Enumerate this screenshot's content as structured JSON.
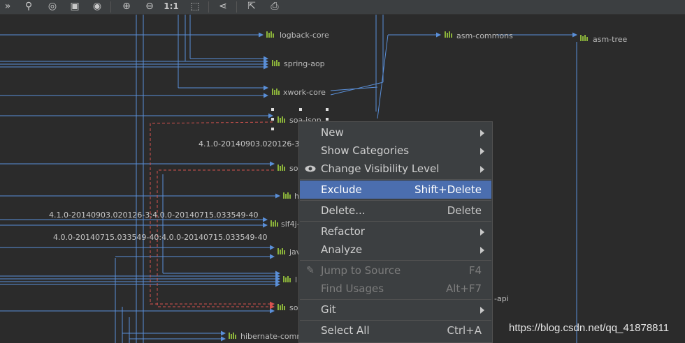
{
  "toolbar": {
    "buttons": [
      {
        "name": "expand-icon",
        "glyph": "»"
      },
      {
        "name": "tree-icon",
        "glyph": "⚲"
      },
      {
        "name": "locate-icon",
        "glyph": "◎"
      },
      {
        "name": "fit-icon",
        "glyph": "▣"
      },
      {
        "name": "eye-icon",
        "glyph": "◉"
      },
      {
        "name": "zoom-in-icon",
        "glyph": "⊕"
      },
      {
        "name": "zoom-out-icon",
        "glyph": "⊖"
      },
      {
        "name": "actual-size-icon",
        "glyph": "1:1"
      },
      {
        "name": "fit-content-icon",
        "glyph": "⬚"
      },
      {
        "name": "share-icon",
        "glyph": "⋖"
      },
      {
        "name": "export-icon",
        "glyph": "⇱"
      },
      {
        "name": "print-icon",
        "glyph": "⎙"
      }
    ]
  },
  "graph": {
    "nodes": {
      "logback_core": "logback-core",
      "spring_aop": "spring-aop",
      "xwork_core": "xwork-core",
      "soa_json": "soa-json",
      "asm_commons": "asm-commons",
      "asm_tree": "asm-tree",
      "soa_2": "so",
      "h_node": "h",
      "slf4j": "slf4j-",
      "java_node": "jav",
      "l_node": "l",
      "soa_3": "so",
      "hibernate_commons": "hibernate-comm",
      "api_node": "-api"
    },
    "edge_labels": {
      "label_1": "4.1.0-20140903.020126-3",
      "label_2": "4.1.0-20140903.020126-3:4.0.0-20140715.033549-40",
      "label_3": "4.0.0-20140715.033549-40:4.0.0-20140715.033549-40"
    }
  },
  "context_menu": {
    "items": [
      {
        "label": "New",
        "shortcut": "",
        "submenu": true,
        "enabled": true
      },
      {
        "label": "Show Categories",
        "shortcut": "",
        "submenu": true,
        "enabled": true
      },
      {
        "label": "Change Visibility Level",
        "shortcut": "",
        "submenu": true,
        "enabled": true,
        "icon": "eye-icon"
      },
      {
        "label": "Exclude",
        "shortcut": "Shift+Delete",
        "submenu": false,
        "enabled": true,
        "selected": true
      },
      {
        "label": "Delete...",
        "shortcut": "Delete",
        "submenu": false,
        "enabled": true
      },
      {
        "label": "Refactor",
        "shortcut": "",
        "submenu": true,
        "enabled": true
      },
      {
        "label": "Analyze",
        "shortcut": "",
        "submenu": true,
        "enabled": true
      },
      {
        "label": "Jump to Source",
        "shortcut": "F4",
        "submenu": false,
        "enabled": false,
        "icon": "pencil-icon"
      },
      {
        "label": "Find Usages",
        "shortcut": "Alt+F7",
        "submenu": false,
        "enabled": false
      },
      {
        "label": "Git",
        "shortcut": "",
        "submenu": true,
        "enabled": true
      },
      {
        "label": "Select All",
        "shortcut": "Ctrl+A",
        "submenu": false,
        "enabled": true
      }
    ]
  },
  "watermark": "https://blog.csdn.net/qq_41878811",
  "colors": {
    "background": "#2b2b2b",
    "edge": "#5a8fd8",
    "edge_highlight": "#d9534f",
    "menu_bg": "#3c3f41",
    "menu_selected": "#4b6eaf",
    "node_icon": "#8bb33a"
  }
}
